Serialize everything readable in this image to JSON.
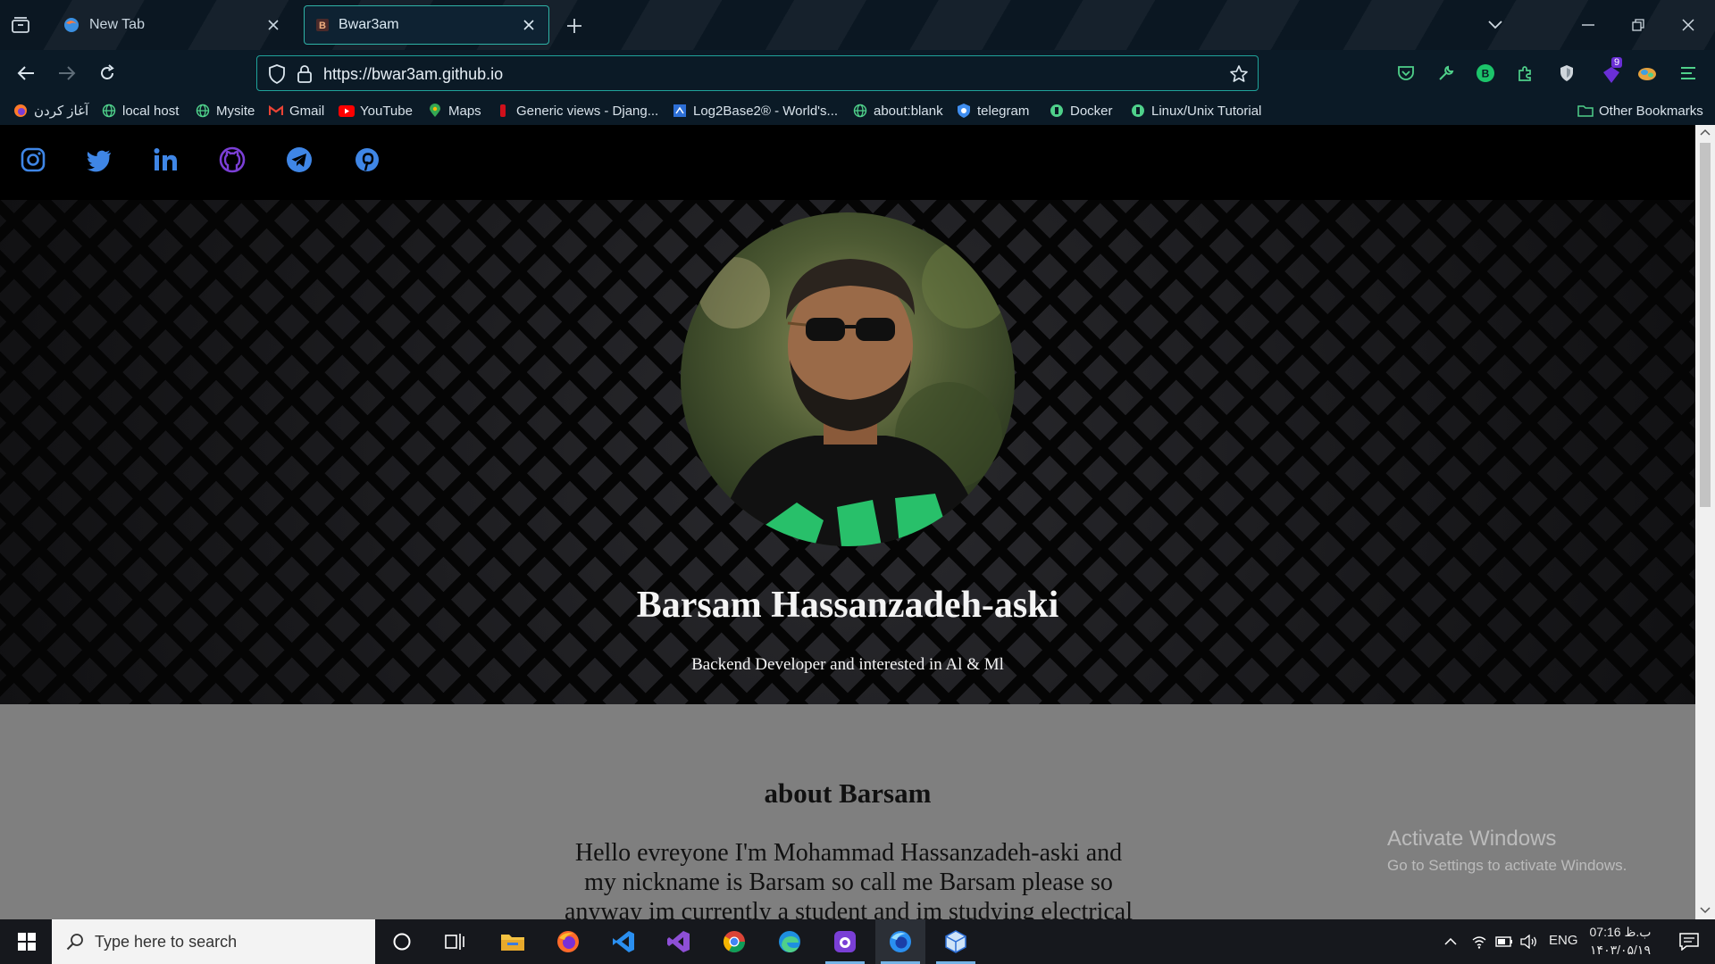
{
  "browser": {
    "tabs": [
      {
        "title": "New Tab",
        "active": false
      },
      {
        "title": "Bwar3am",
        "active": true
      }
    ],
    "url": "https://bwar3am.github.io",
    "extension_badge": "9",
    "accent_color": "#2fb3a7"
  },
  "bookmarks": {
    "items": [
      {
        "label": "آغاز کردن",
        "icon": "firefox-icon"
      },
      {
        "label": "local host",
        "icon": "globe-icon"
      },
      {
        "label": "Mysite",
        "icon": "globe-icon"
      },
      {
        "label": "Gmail",
        "icon": "gmail-icon"
      },
      {
        "label": "YouTube",
        "icon": "youtube-icon"
      },
      {
        "label": "Maps",
        "icon": "maps-pin-icon"
      },
      {
        "label": "Generic views - Djang...",
        "icon": "django-icon"
      },
      {
        "label": "Log2Base2® - World's...",
        "icon": "log2base2-icon"
      },
      {
        "label": "about:blank",
        "icon": "globe-icon"
      },
      {
        "label": "telegram",
        "icon": "telegram-shield-icon"
      },
      {
        "label": "Docker",
        "icon": "docker-icon"
      },
      {
        "label": "Linux/Unix Tutorial",
        "icon": "tutorial-icon"
      }
    ],
    "other": "Other Bookmarks"
  },
  "page": {
    "social": [
      "instagram-icon",
      "twitter-icon",
      "linkedin-icon",
      "github-icon",
      "telegram-icon",
      "pinterest-icon"
    ],
    "hero": {
      "name": "Barsam Hassanzadeh-aski",
      "subtitle": "Backend Developer and interested in Al & Ml"
    },
    "about": {
      "title": "about Barsam",
      "text": "Hello evreyone I'm Mohammad Hassanzadeh-aski and my nickname is Barsam so call me Barsam please so anyway im currently a student and im studying electrical"
    }
  },
  "watermark": {
    "line1": "Activate Windows",
    "line2": "Go to Settings to activate Windows."
  },
  "taskbar": {
    "search_placeholder": "Type here to search",
    "language": "ENG",
    "time": "07:16 ب.ظ",
    "date": "۱۴۰۳/۰۵/۱۹"
  }
}
